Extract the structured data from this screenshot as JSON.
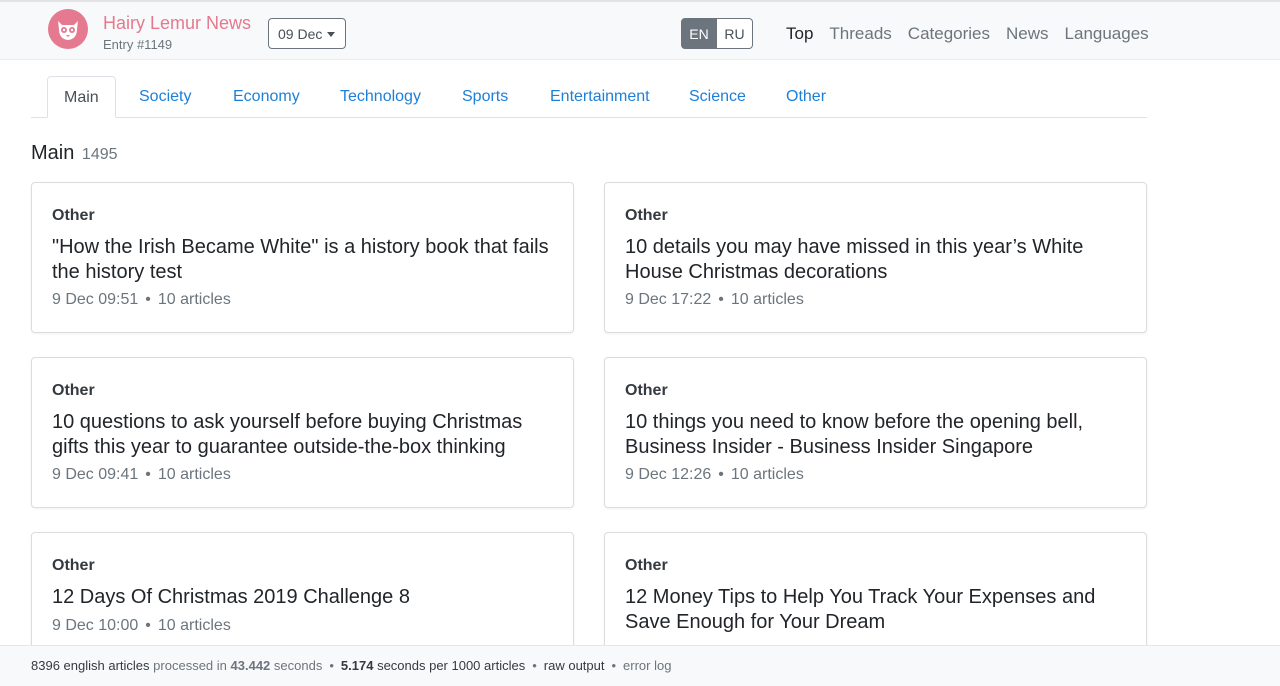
{
  "brand": {
    "title": "Hairy Lemur News",
    "subtitle": "Entry #1149",
    "logo_icon": "lemur-face-icon",
    "color": "#e5798f"
  },
  "date_select": {
    "value": "09 Dec"
  },
  "languages": [
    {
      "label": "EN",
      "active": true
    },
    {
      "label": "RU",
      "active": false
    }
  ],
  "top_nav": [
    {
      "label": "Top",
      "active": true
    },
    {
      "label": "Threads",
      "active": false
    },
    {
      "label": "Categories",
      "active": false
    },
    {
      "label": "News",
      "active": false
    },
    {
      "label": "Languages",
      "active": false
    }
  ],
  "tabs": [
    {
      "label": "Main",
      "active": true
    },
    {
      "label": "Society",
      "active": false
    },
    {
      "label": "Economy",
      "active": false
    },
    {
      "label": "Technology",
      "active": false
    },
    {
      "label": "Sports",
      "active": false
    },
    {
      "label": "Entertainment",
      "active": false
    },
    {
      "label": "Science",
      "active": false
    },
    {
      "label": "Other",
      "active": false
    }
  ],
  "section": {
    "title": "Main",
    "count": "1495"
  },
  "cards": [
    {
      "category": "Other",
      "title": "\"How the Irish Became White\" is a history book that fails the history test",
      "time": "9 Dec 09:51",
      "articles": "10 articles"
    },
    {
      "category": "Other",
      "title": "10 details you may have missed in this year’s White House Christmas decorations",
      "time": "9 Dec 17:22",
      "articles": "10 articles"
    },
    {
      "category": "Other",
      "title": "10 questions to ask yourself before buying Christmas gifts this year to guarantee outside-the-box thinking",
      "time": "9 Dec 09:41",
      "articles": "10 articles"
    },
    {
      "category": "Other",
      "title": "10 things you need to know before the opening bell, Business Insider - Business Insider Singapore",
      "time": "9 Dec 12:26",
      "articles": "10 articles"
    },
    {
      "category": "Other",
      "title": "12 Days Of Christmas 2019 Challenge 8",
      "time": "9 Dec 10:00",
      "articles": "10 articles"
    },
    {
      "category": "Other",
      "title": "12 Money Tips to Help You Track Your Expenses and Save Enough for Your Dream",
      "time": "",
      "articles": ""
    }
  ],
  "meta_separator": "•",
  "footer": {
    "articles_count": "8396",
    "articles_text": "english articles",
    "processed_in": "processed in",
    "seconds_value": "43.442",
    "seconds_text": "seconds",
    "per_value": "5.174",
    "per_text": "seconds per 1000 articles",
    "raw_output": "raw output",
    "error_log": "error log",
    "separator": "•"
  }
}
